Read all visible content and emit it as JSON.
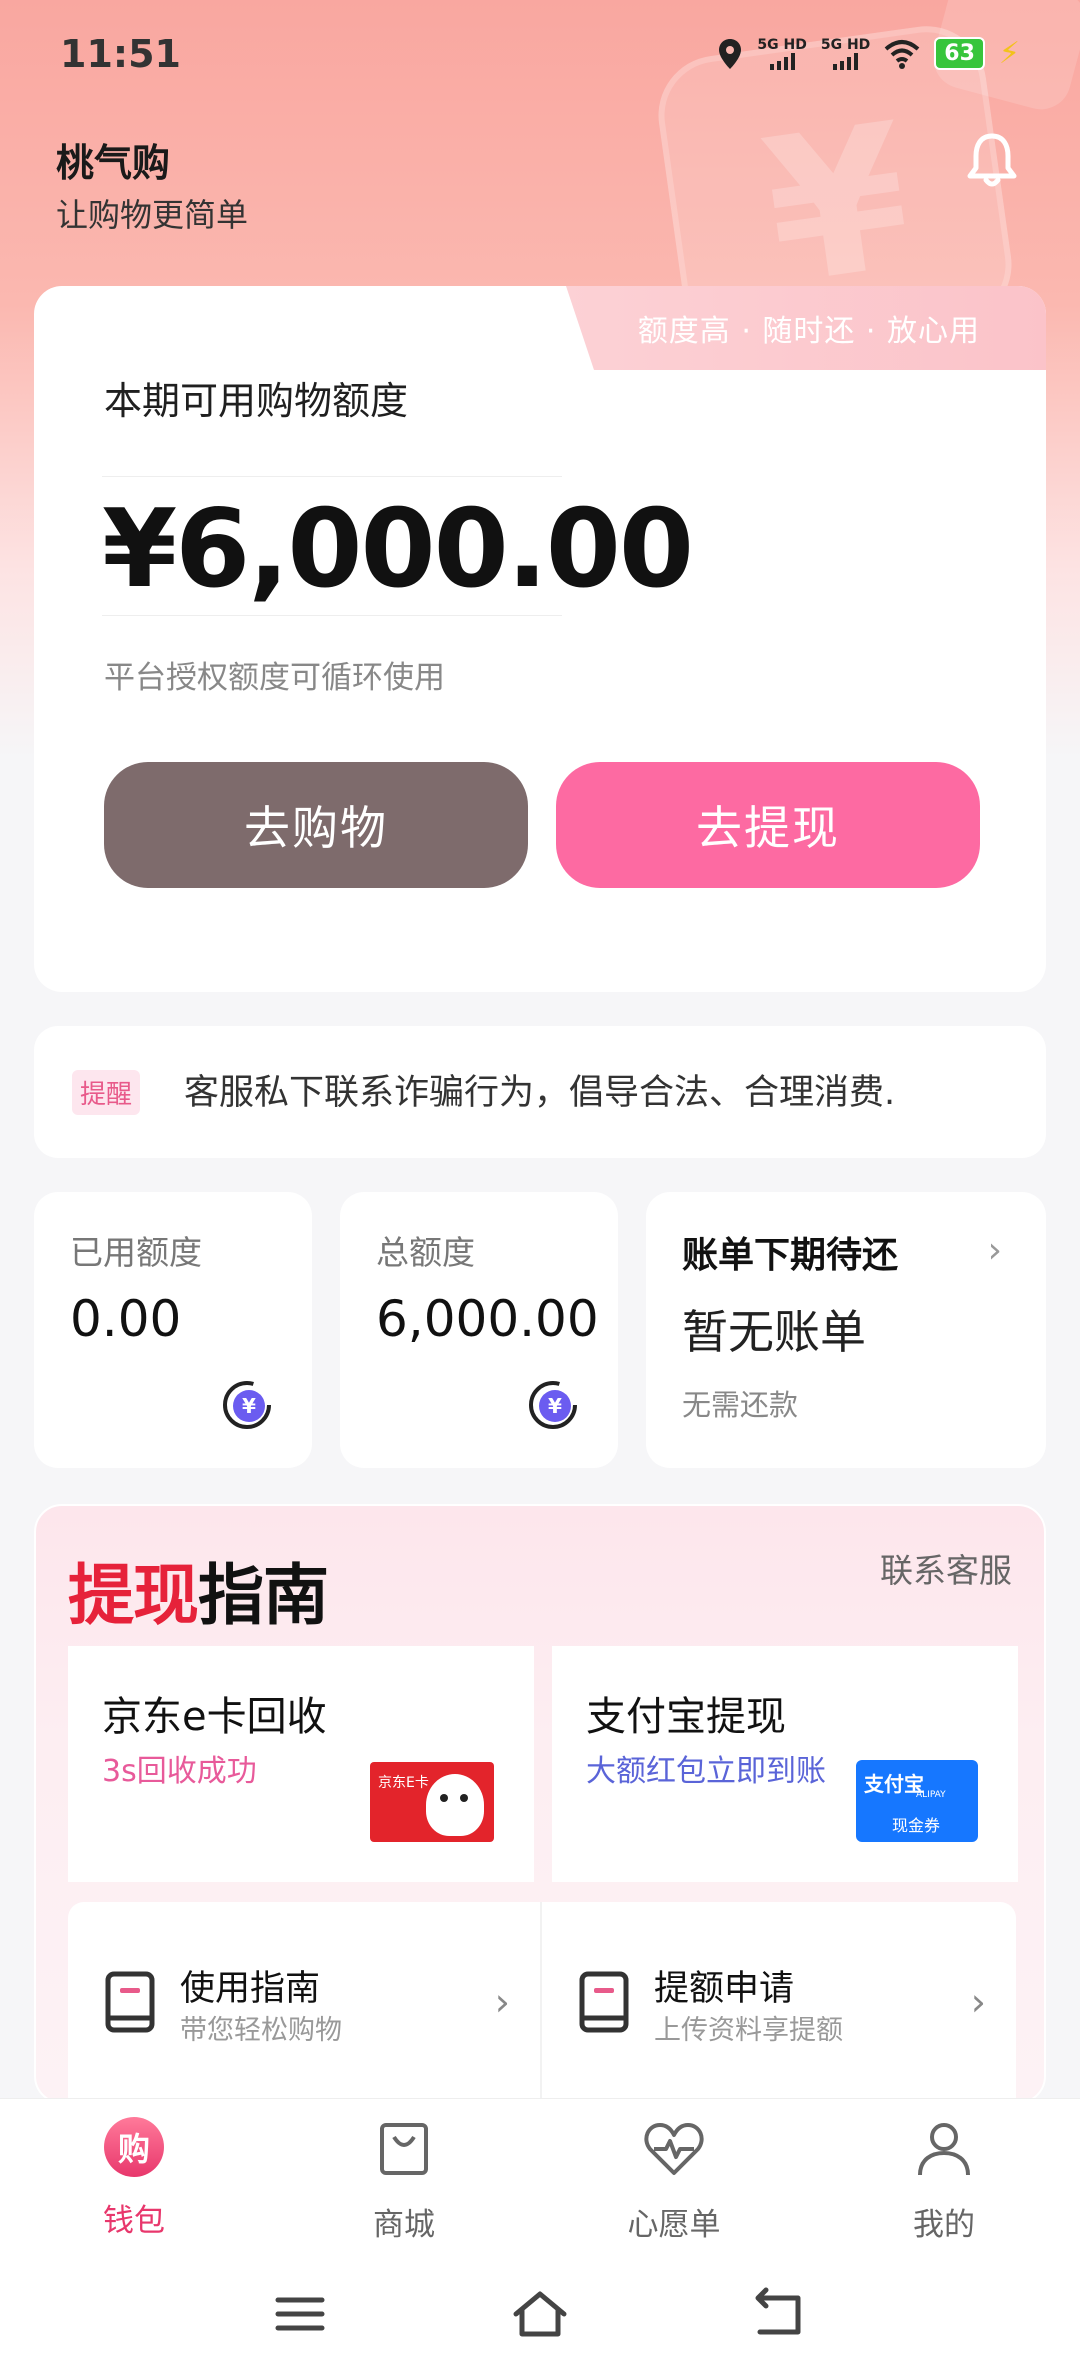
{
  "status_bar": {
    "time": "11:51",
    "signal1": "5G HD",
    "signal2": "5G HD",
    "battery": "63"
  },
  "header": {
    "app_name": "桃气购",
    "tagline": "让购物更简单"
  },
  "credit_card": {
    "tag_text": "额度高 · 随时还 · 放心用",
    "label": "本期可用购物额度",
    "amount": "¥6,000.00",
    "note": "平台授权额度可循环使用",
    "shop_button": "去购物",
    "withdraw_button": "去提现"
  },
  "notice": {
    "tag": "提醒",
    "text": "客服私下联系诈骗行为，倡导合法、合理消费."
  },
  "stats": {
    "used_label": "已用额度",
    "used_value": "0.00",
    "total_label": "总额度",
    "total_value": "6,000.00",
    "bill_title": "账单下期待还",
    "bill_status": "暂无账单",
    "bill_note": "无需还款"
  },
  "guide": {
    "title_red": "提现",
    "title_black": "指南",
    "contact": "联系客服",
    "items": [
      {
        "title": "京东e卡回收",
        "subtitle": "3s回收成功",
        "image_text": "京东E卡"
      },
      {
        "title": "支付宝提现",
        "subtitle": "大额红包立即到账",
        "image_text1": "支付宝",
        "image_text2": "ALIPAY",
        "image_text3": "现金券"
      }
    ],
    "bottom": [
      {
        "title": "使用指南",
        "subtitle": "带您轻松购物"
      },
      {
        "title": "提额申请",
        "subtitle": "上传资料享提额"
      }
    ]
  },
  "tabbar": {
    "wallet_badge": "购",
    "tabs": [
      {
        "label": "钱包",
        "active": true
      },
      {
        "label": "商城",
        "active": false
      },
      {
        "label": "心愿单",
        "active": false
      },
      {
        "label": "我的",
        "active": false
      }
    ]
  },
  "colors": {
    "accent_pink": "#fd6aa2",
    "shop_button": "#7e6b6c",
    "active_tab": "#e8376c",
    "guide_red": "#e6223a",
    "alipay_blue": "#1677ff",
    "jd_red": "#e3242b"
  }
}
